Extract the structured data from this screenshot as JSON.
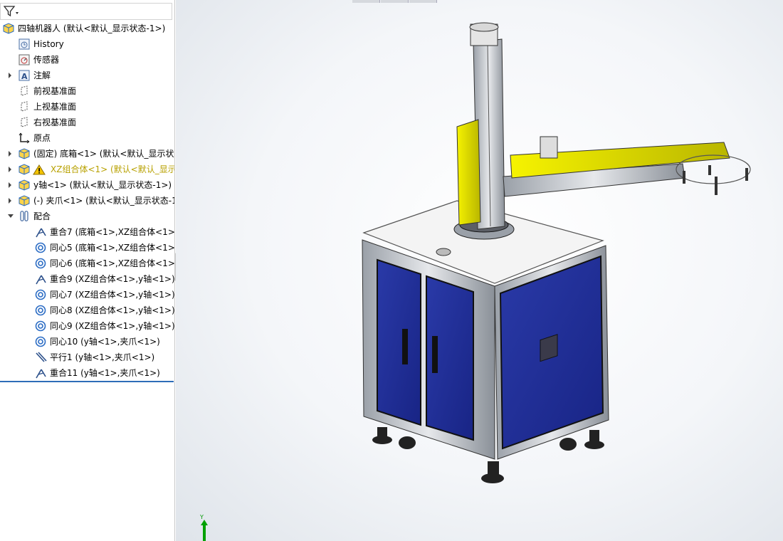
{
  "feature_tree": {
    "root": {
      "label": "四轴机器人  (默认<默认_显示状态-1>)",
      "icon": "assembly-icon"
    },
    "items": [
      {
        "label": "History",
        "icon": "history-icon",
        "level": 1,
        "expandable": false
      },
      {
        "label": "传感器",
        "icon": "sensor-icon",
        "level": 1,
        "expandable": false
      },
      {
        "label": "注解",
        "icon": "annotation-icon",
        "level": 1,
        "expandable": true
      },
      {
        "label": "前视基准面",
        "icon": "plane-icon",
        "level": 1,
        "expandable": false
      },
      {
        "label": "上视基准面",
        "icon": "plane-icon",
        "level": 1,
        "expandable": false
      },
      {
        "label": "右视基准面",
        "icon": "plane-icon",
        "level": 1,
        "expandable": false
      },
      {
        "label": "原点",
        "icon": "origin-icon",
        "level": 1,
        "expandable": false
      },
      {
        "label": "(固定) 底箱<1> (默认<默认_显示状态",
        "icon": "part-icon",
        "level": 1,
        "expandable": true
      },
      {
        "label": "XZ组合体<1> (默认<默认_显示状",
        "icon": "subassembly-warning-icon",
        "level": 1,
        "expandable": true,
        "warning": true
      },
      {
        "label": "y轴<1> (默认<默认_显示状态-1>)",
        "icon": "subassembly-icon",
        "level": 1,
        "expandable": true
      },
      {
        "label": "(-) 夹爪<1> (默认<默认_显示状态-1",
        "icon": "subassembly-icon",
        "level": 1,
        "expandable": true
      },
      {
        "label": "配合",
        "icon": "mates-folder-icon",
        "level": 1,
        "expandable": true,
        "expanded": true
      }
    ],
    "mates": [
      {
        "label": "重合7 (底箱<1>,XZ组合体<1>)",
        "icon": "coincident-mate-icon"
      },
      {
        "label": "同心5 (底箱<1>,XZ组合体<1>)",
        "icon": "concentric-mate-icon"
      },
      {
        "label": "同心6 (底箱<1>,XZ组合体<1>)",
        "icon": "concentric-mate-icon"
      },
      {
        "label": "重合9 (XZ组合体<1>,y轴<1>)",
        "icon": "coincident-mate-icon"
      },
      {
        "label": "同心7 (XZ组合体<1>,y轴<1>)",
        "icon": "concentric-mate-icon"
      },
      {
        "label": "同心8 (XZ组合体<1>,y轴<1>)",
        "icon": "concentric-mate-icon"
      },
      {
        "label": "同心9 (XZ组合体<1>,y轴<1>)",
        "icon": "concentric-mate-icon"
      },
      {
        "label": "同心10 (y轴<1>,夹爪<1>)",
        "icon": "concentric-mate-icon"
      },
      {
        "label": "平行1 (y轴<1>,夹爪<1>)",
        "icon": "parallel-mate-icon"
      },
      {
        "label": "重合11 (y轴<1>,夹爪<1>)",
        "icon": "coincident-mate-icon"
      }
    ]
  },
  "filter": {
    "icon": "filter-icon"
  },
  "viewport": {
    "model": "four-axis-robot-model",
    "triad_axis_label": "Y",
    "colors": {
      "cabinet_panel": "#1f2d9a",
      "frame": "#b9bec6",
      "arm_yellow": "#e3e000",
      "top_plate": "#f2f2f2"
    }
  },
  "colors": {
    "accent_line": "#2e6db8",
    "warning_text": "#b8a100"
  }
}
